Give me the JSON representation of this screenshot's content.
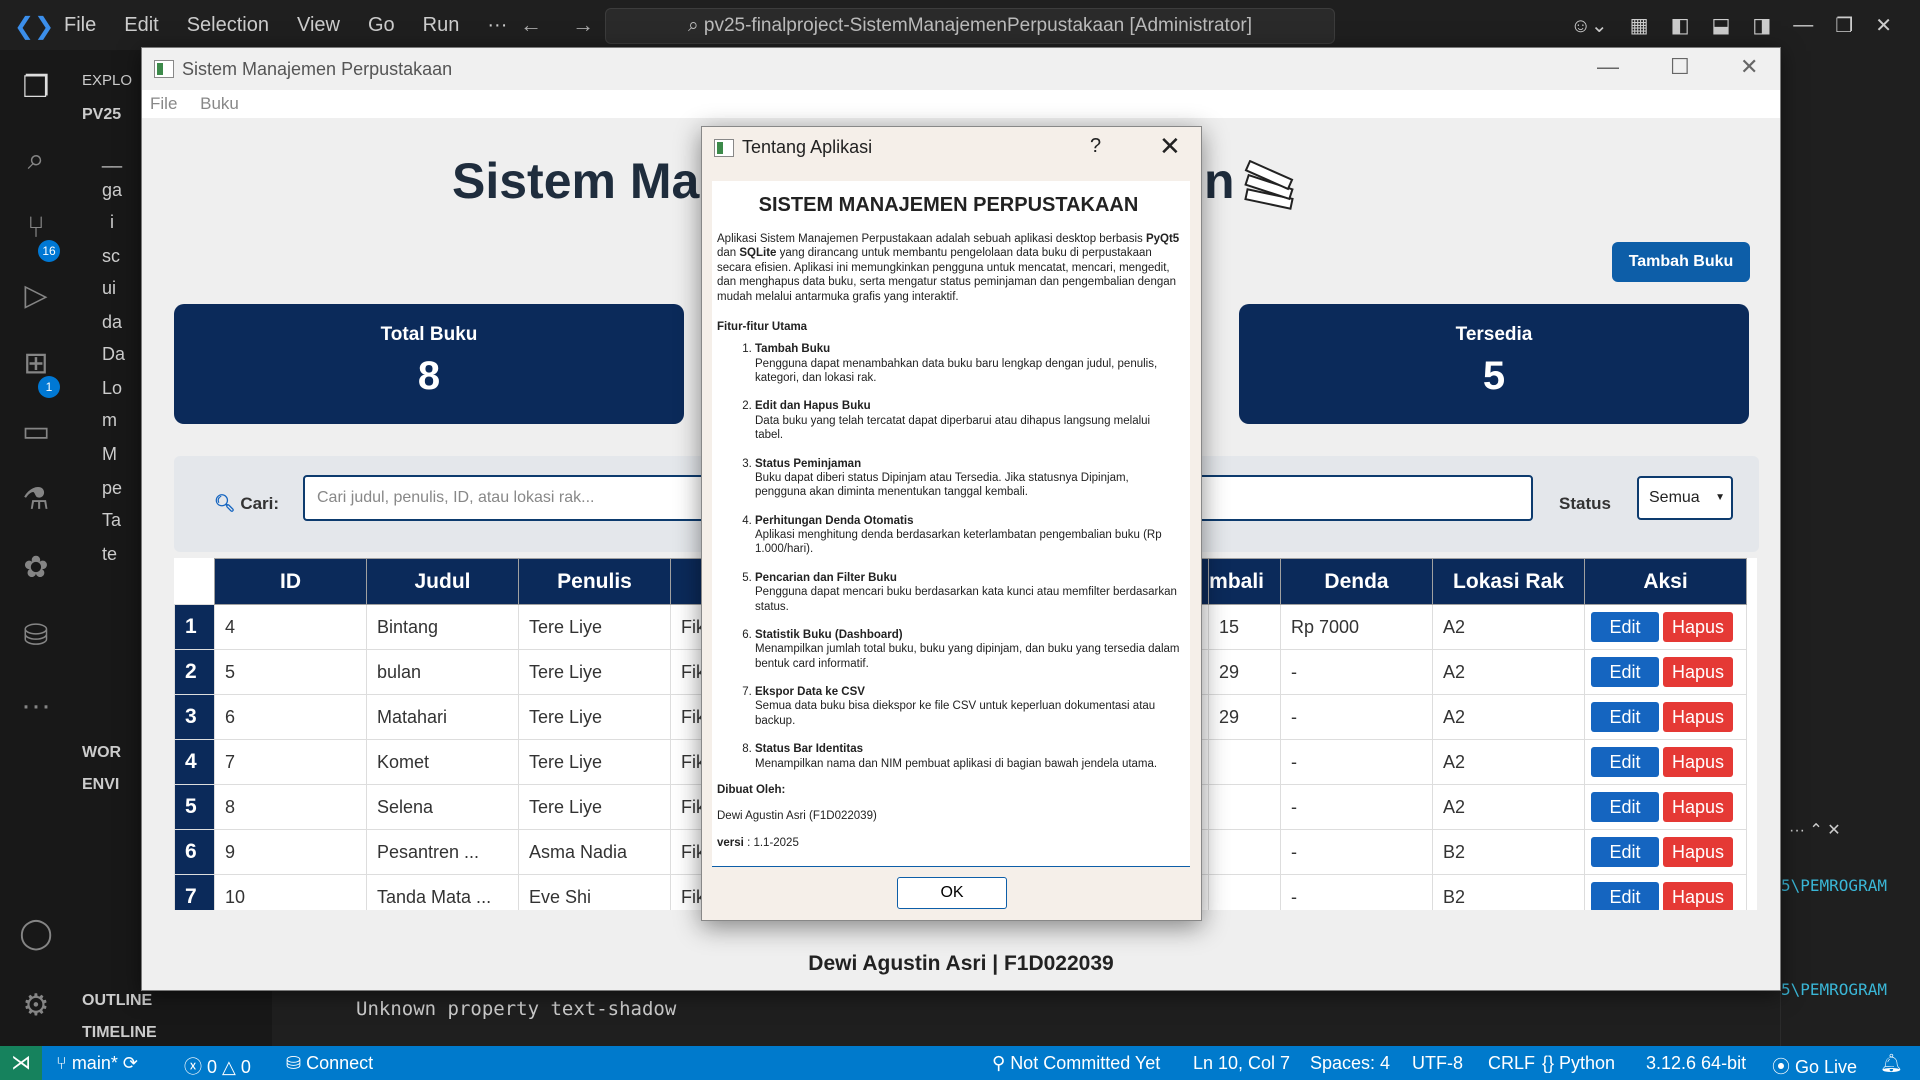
{
  "vscode": {
    "menu": [
      "File",
      "Edit",
      "Selection",
      "View",
      "Go",
      "Run",
      "···"
    ],
    "search": "pv25-finalproject-SistemManajemenPerpustakaan [Administrator]",
    "sidebar_rows": [
      "EXPLO",
      "PV25",
      "__",
      "ga",
      "i",
      "sc",
      "ui",
      "da",
      "Da",
      "Lo",
      "m",
      "M",
      "pe",
      "Ta",
      "te",
      "WOR",
      "ENVI",
      "OUTLINE",
      "TIMELINE"
    ],
    "badges": {
      "scm": "16",
      "ext": "1"
    },
    "terminal_line": "Unknown property text-shadow",
    "right_path_1": "5\\PEMROGRAM",
    "right_path_2": "5\\PEMROGRAM",
    "status": {
      "branch": "main*",
      "errors": "0",
      "warnings": "0",
      "connect": "Connect",
      "commit": "Not Committed Yet",
      "position": "Ln 10, Col 7",
      "spaces": "Spaces: 4",
      "encoding": "UTF-8",
      "eol": "CRLF",
      "language": "Python",
      "version": "3.12.6 64-bit",
      "golive": "Go Live"
    }
  },
  "app": {
    "title": "Sistem Manajemen Perpustakaan",
    "menu": [
      "File",
      "Buku"
    ],
    "heading_left": "Sistem Man",
    "heading_right": "n",
    "add_button": "Tambah Buku",
    "cards": [
      {
        "label": "Total Buku",
        "value": "8"
      },
      {
        "label": "Tersedia",
        "value": "5"
      }
    ],
    "search_label": "Cari:",
    "search_placeholder": "Cari judul, penulis, ID, atau lokasi rak...",
    "status_label": "Status",
    "status_value": "Semua",
    "table": {
      "headers": [
        "ID",
        "Judul",
        "Penulis",
        "K",
        "mbali",
        "Denda",
        "Lokasi Rak",
        "Aksi"
      ],
      "rows": [
        {
          "n": "1",
          "id": "4",
          "judul": "Bintang",
          "penulis": "Tere Liye",
          "k": "Fiks",
          "kembali": "15",
          "denda": "Rp 7000",
          "rak": "A2"
        },
        {
          "n": "2",
          "id": "5",
          "judul": "bulan",
          "penulis": "Tere Liye",
          "k": "Fiks",
          "kembali": "29",
          "denda": "-",
          "rak": "A2"
        },
        {
          "n": "3",
          "id": "6",
          "judul": "Matahari",
          "penulis": "Tere Liye",
          "k": "Fiks",
          "kembali": "29",
          "denda": "-",
          "rak": "A2"
        },
        {
          "n": "4",
          "id": "7",
          "judul": "Komet",
          "penulis": "Tere Liye",
          "k": "Fiks",
          "kembali": "",
          "denda": "-",
          "rak": "A2"
        },
        {
          "n": "5",
          "id": "8",
          "judul": "Selena",
          "penulis": "Tere Liye",
          "k": "Fiks",
          "kembali": "",
          "denda": "-",
          "rak": "A2"
        },
        {
          "n": "6",
          "id": "9",
          "judul": "Pesantren ...",
          "penulis": "Asma Nadia",
          "k": "Fiks",
          "kembali": "",
          "denda": "-",
          "rak": "B2"
        },
        {
          "n": "7",
          "id": "10",
          "judul": "Tanda Mata ...",
          "penulis": "Eve Shi",
          "k": "Fiks",
          "kembali": "",
          "denda": "-",
          "rak": "B2"
        }
      ],
      "edit_label": "Edit",
      "delete_label": "Hapus"
    },
    "footer": "Dewi Agustin Asri  |  F1D022039"
  },
  "dialog": {
    "title": "Tentang Aplikasi",
    "help": "?",
    "heading": "SISTEM MANAJEMEN PERPUSTAKAAN",
    "intro_1": "Aplikasi Sistem Manajemen Perpustakaan adalah sebuah aplikasi desktop berbasis ",
    "intro_pyqt": "PyQt5",
    "intro_2": " dan ",
    "intro_sqlite": "SQLite",
    "intro_3": " yang dirancang untuk membantu pengelolaan data buku di perpustakaan secara efisien. Aplikasi ini memungkinkan pengguna untuk mencatat, mencari, mengedit, dan menghapus data buku, serta mengatur status peminjaman dan pengembalian dengan mudah melalui antarmuka grafis yang interaktif.",
    "features_title": "Fitur-fitur Utama",
    "features": [
      {
        "t": "Tambah Buku",
        "d": "Pengguna dapat menambahkan data buku baru lengkap dengan judul, penulis, kategori, dan lokasi rak."
      },
      {
        "t": "Edit dan Hapus Buku",
        "d": "Data buku yang telah tercatat dapat diperbarui atau dihapus langsung melalui tabel."
      },
      {
        "t": "Status Peminjaman",
        "d": "Buku dapat diberi status Dipinjam atau Tersedia. Jika statusnya Dipinjam, pengguna akan diminta menentukan tanggal kembali."
      },
      {
        "t": "Perhitungan Denda Otomatis",
        "d": "Aplikasi menghitung denda berdasarkan keterlambatan pengembalian buku (Rp 1.000/hari)."
      },
      {
        "t": "Pencarian dan Filter Buku",
        "d": "Pengguna dapat mencari buku berdasarkan kata kunci atau memfilter berdasarkan status."
      },
      {
        "t": "Statistik Buku (Dashboard)",
        "d": "Menampilkan jumlah total buku, buku yang dipinjam, dan buku yang tersedia dalam bentuk card informatif."
      },
      {
        "t": "Ekspor Data ke CSV",
        "d": "Semua data buku bisa diekspor ke file CSV untuk keperluan dokumentasi atau backup."
      },
      {
        "t": "Status Bar Identitas",
        "d": "Menampilkan nama dan NIM pembuat aplikasi di bagian bawah jendela utama."
      }
    ],
    "author_title": "Dibuat Oleh:",
    "author": "Dewi Agustin Asri (F1D022039)",
    "version_label": "versi",
    "version": ": 1.1-2025",
    "ok": "OK"
  }
}
